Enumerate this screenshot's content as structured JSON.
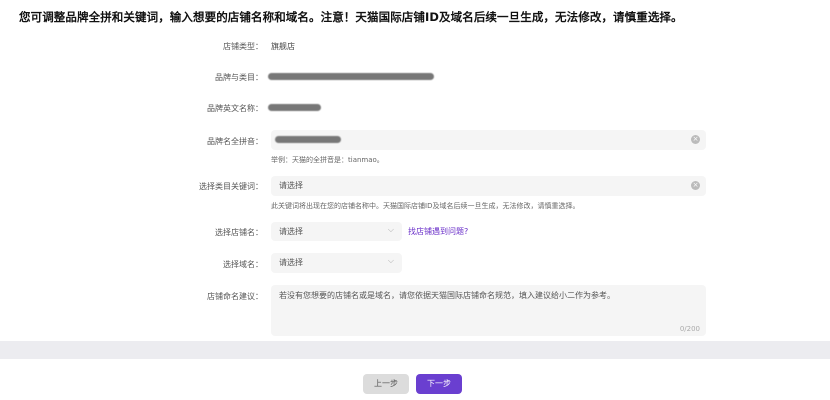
{
  "header": {
    "notice": "您可调整品牌全拼和关键词，输入想要的店铺名称和域名。注意！天猫国际店铺ID及域名后续一旦生成，无法修改，请慎重选择。"
  },
  "form": {
    "store_type": {
      "label": "店铺类型：",
      "value": "旗舰店"
    },
    "brand_category": {
      "label": "品牌与类目："
    },
    "brand_english": {
      "label": "品牌英文名称："
    },
    "brand_pinyin": {
      "label": "品牌名全拼音：",
      "hint": "举例：天猫的全拼音是：tianmao。"
    },
    "category_keyword": {
      "label": "选择类目关键词：",
      "placeholder": "请选择",
      "hint": "此关键词将出现在您的店铺名称中。天猫国际店铺ID及域名后续一旦生成，无法修改，请慎重选择。"
    },
    "store_name": {
      "label": "选择店铺名：",
      "placeholder": "请选择",
      "help_link": "找店铺遇到问题?"
    },
    "domain": {
      "label": "选择域名：",
      "placeholder": "请选择"
    },
    "suggestion": {
      "label": "店铺命名建议：",
      "placeholder": "若没有您想要的店铺名或是域名，请您依据天猫国际店铺命名规范，填入建议给小二作为参考。",
      "counter": "0/200"
    }
  },
  "footer": {
    "prev_label": "上一步",
    "next_label": "下一步"
  },
  "icons": {
    "clear": "clear-circle-icon",
    "dropdown": "chevron-down-icon"
  },
  "colors": {
    "accent": "#6a3fd0",
    "link": "#6a2fc9"
  }
}
